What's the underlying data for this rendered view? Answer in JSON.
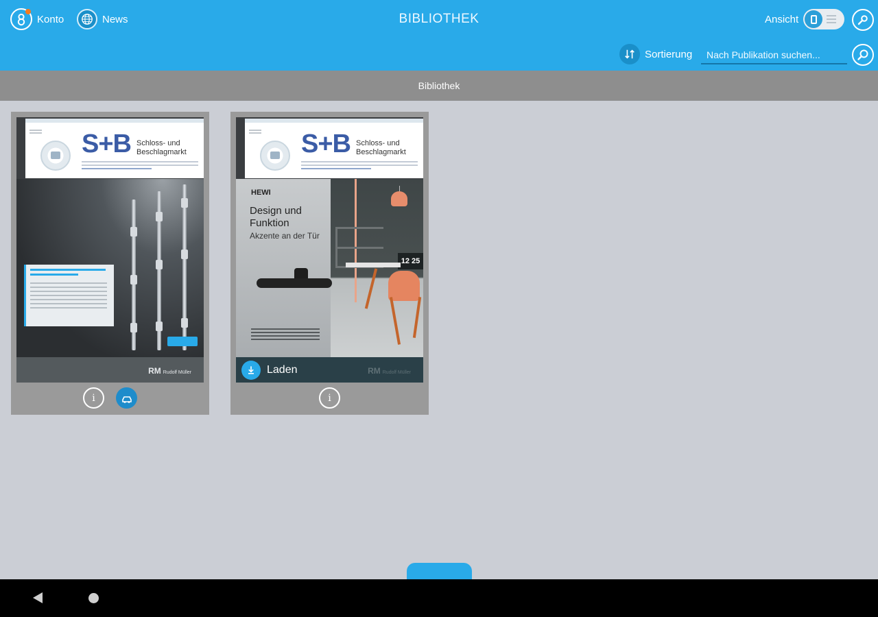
{
  "header": {
    "account_label": "Konto",
    "news_label": "News",
    "title": "BIBLIOTHEK",
    "view_label": "Ansicht",
    "sort_label": "Sortierung",
    "search_placeholder": "Nach Publikation suchen..."
  },
  "section": {
    "title": "Bibliothek"
  },
  "publications": [
    {
      "masthead": "S+B",
      "masthead_sub": "Schloss- und Beschlagmarkt",
      "publisher": "RM",
      "publisher_sub": "Rudolf Müller",
      "downloaded": true
    },
    {
      "masthead": "S+B",
      "masthead_sub": "Schloss- und Beschlagmarkt",
      "brand": "HEWI",
      "headline": "Design und Funktion",
      "subheadline": "Akzente an der Tür",
      "clock": "12 25",
      "publisher": "RM",
      "publisher_sub": "Rudolf Müller",
      "action_label": "Laden",
      "downloaded": false
    }
  ],
  "colors": {
    "accent": "#29aae9",
    "section_bar": "#8e8e8e",
    "background": "#cbced5",
    "notification": "#f47b20"
  },
  "icons": {
    "account": "user-icon",
    "news": "globe-icon",
    "view_toggle": "view-toggle",
    "settings": "wrench-icon",
    "sort": "sort-icon",
    "search": "search-icon",
    "info": "info-icon",
    "downloaded": "car-cloud-icon",
    "download": "download-icon"
  }
}
